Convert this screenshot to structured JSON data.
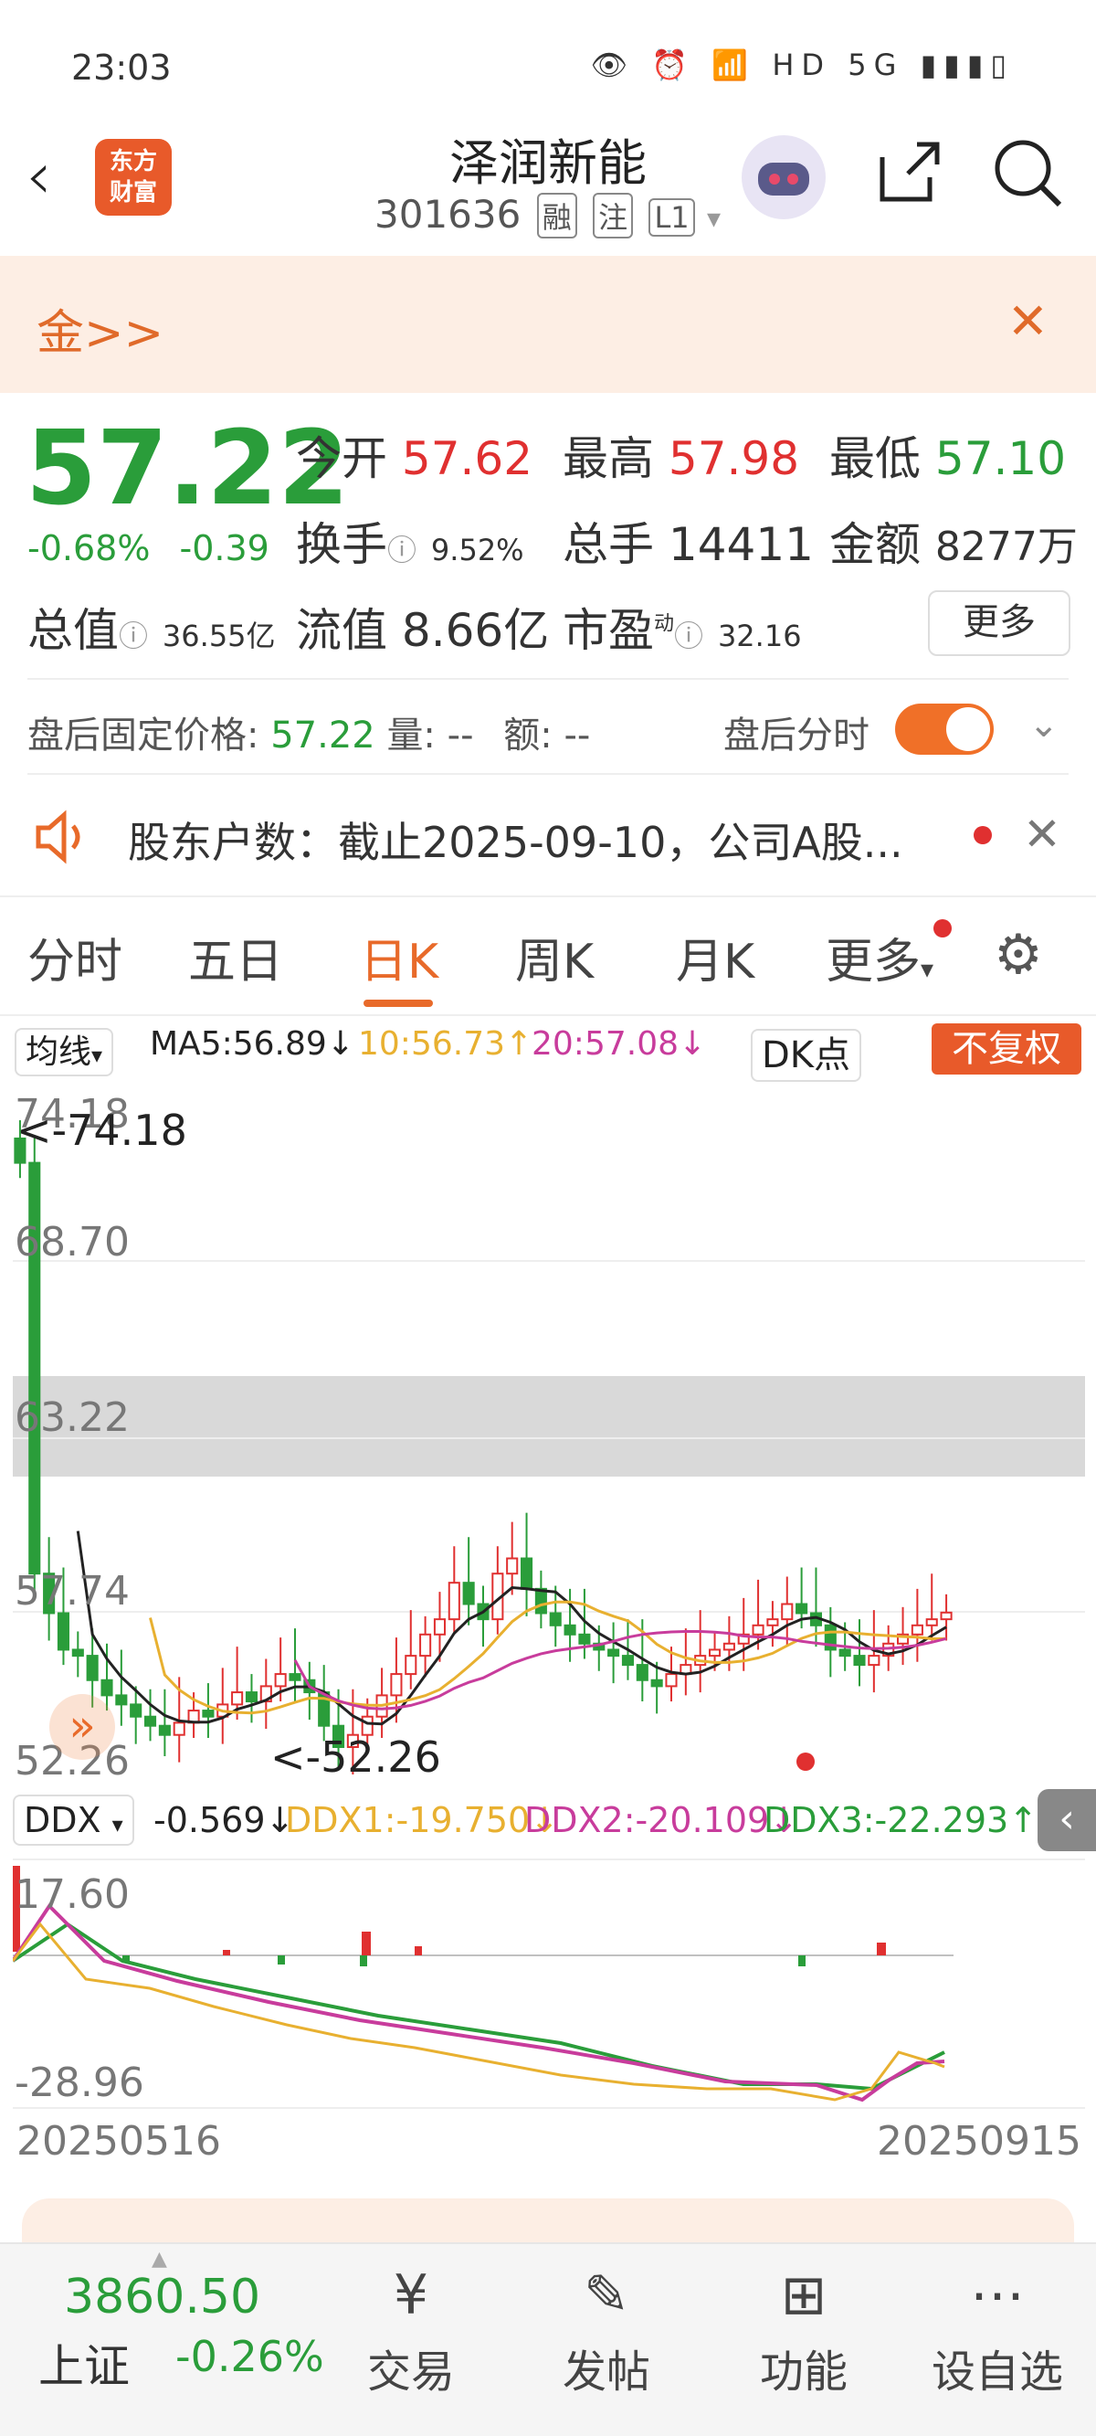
{
  "status": {
    "time": "23:03",
    "icons": "👁 ⏰ 📶 HD 5G ▮▮▮▯"
  },
  "header": {
    "stock_name": "泽润新能",
    "stock_code": "301636",
    "tags": [
      "融",
      "注",
      "L1"
    ],
    "brand": [
      "东方",
      "财富"
    ]
  },
  "ad": {
    "text": "金>>"
  },
  "quote": {
    "price": "57.22",
    "change_pct": "-0.68%",
    "change": "-0.39",
    "open_label": "今开",
    "open": "57.62",
    "high_label": "最高",
    "high": "57.98",
    "low_label": "最低",
    "low": "57.10",
    "turnover_label": "换手",
    "turnover": "9.52%",
    "volume_label": "总手",
    "volume": "14411",
    "amount_label": "金额",
    "amount": "8277万",
    "mktcap_label": "总值",
    "mktcap": "36.55亿",
    "float_label": "流值",
    "float": "8.66亿",
    "pe_label": "市盈",
    "pe_sup": "动",
    "pe": "32.16",
    "more": "更多"
  },
  "after_hours": {
    "price_label": "盘后固定价格:",
    "price": "57.22",
    "vol_label": "量:",
    "vol": "--",
    "amt_label": "额:",
    "amt": "--",
    "toggle_label": "盘后分时"
  },
  "notice": {
    "text": "股东户数：截止2025-09-10，公司A股..."
  },
  "tabs": [
    "分时",
    "五日",
    "日K",
    "周K",
    "月K",
    "更多",
    "⚙"
  ],
  "ma": {
    "selector": "均线",
    "ma5": "MA5:56.89↓",
    "ma10": "10:56.73↑",
    "ma20": "20:57.08↓",
    "dk": "DK点",
    "fq": "不复权",
    "color_ma5": "#222222",
    "color_ma10": "#e8b030",
    "color_ma20": "#c83c9c"
  },
  "chart": {
    "y_labels": [
      "74.18",
      "68.70",
      "63.22",
      "57.74",
      "52.26"
    ],
    "max_marker": "<-74.18",
    "min_marker": "<-52.26"
  },
  "ddx": {
    "selector": "DDX",
    "ddx": "-0.569↓",
    "ddx1": "DDX1:-19.750↓",
    "ddx2": "DDX2:-20.109↓",
    "ddx3": "DDX3:-22.293↑",
    "y_top": "17.60",
    "y_bottom": "-28.96",
    "date_start": "20250516",
    "date_end": "20250915"
  },
  "bottom": {
    "index_value": "3860.50",
    "index_name": "上证",
    "index_change": "-0.26%",
    "nav": [
      {
        "icon": "¥",
        "label": "交易"
      },
      {
        "icon": "✎",
        "label": "发帖"
      },
      {
        "icon": "⊞",
        "label": "功能"
      },
      {
        "icon": "⋯",
        "label": "设自选"
      }
    ]
  },
  "chart_data": {
    "type": "candlestick",
    "ylim": [
      52.26,
      74.18
    ],
    "close": [
      72.0,
      58.5,
      57.2,
      56.0,
      55.8,
      55.0,
      54.5,
      54.2,
      53.8,
      53.5,
      53.2,
      53.6,
      54.0,
      53.8,
      54.2,
      54.6,
      54.3,
      54.8,
      55.2,
      55.0,
      54.6,
      53.5,
      52.8,
      53.2,
      53.8,
      54.5,
      55.2,
      55.8,
      56.5,
      57.0,
      58.2,
      57.5,
      57.0,
      58.5,
      59.0,
      58.0,
      57.2,
      56.8,
      56.5,
      56.2,
      56.0,
      55.8,
      55.5,
      55.0,
      54.8,
      55.2,
      55.5,
      55.8,
      56.0,
      56.2,
      56.5,
      56.8,
      57.0,
      57.5,
      57.2,
      56.8,
      56.0,
      55.8,
      55.5,
      55.8,
      56.2,
      56.5,
      56.8,
      57.0,
      57.22
    ]
  }
}
